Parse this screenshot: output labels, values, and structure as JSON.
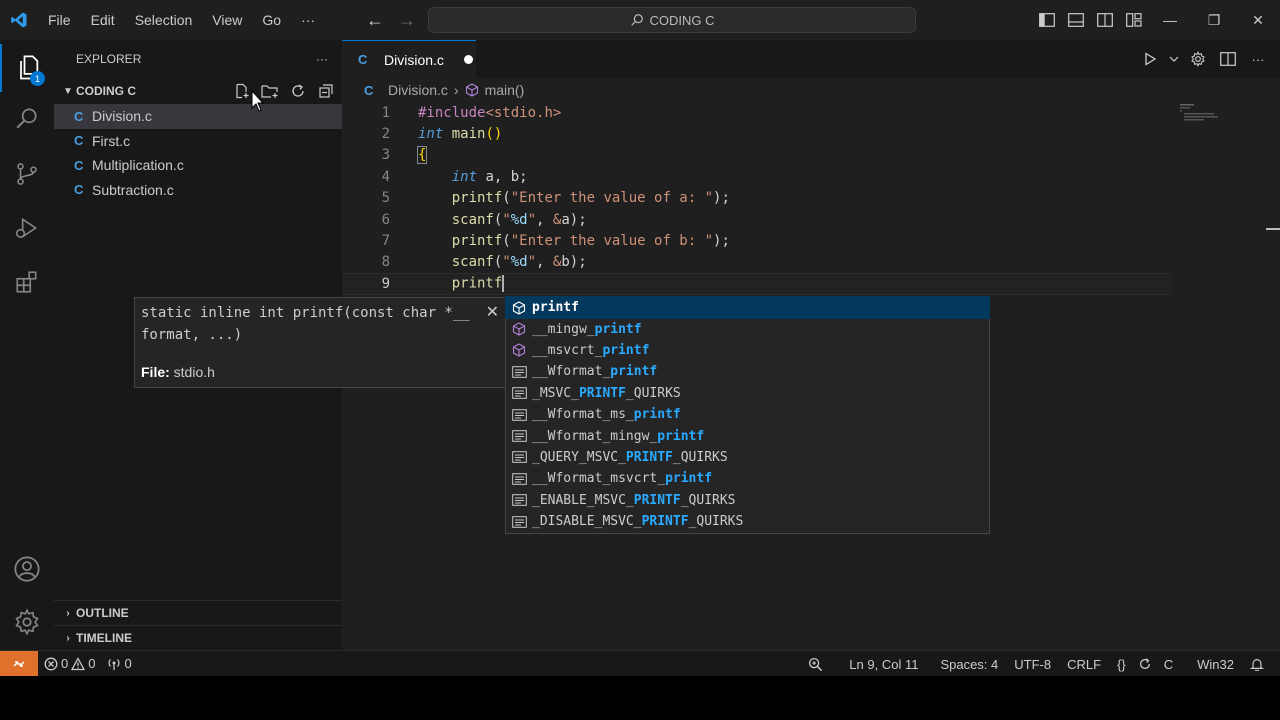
{
  "titlebar": {
    "menu": [
      "File",
      "Edit",
      "Selection",
      "View",
      "Go",
      "···"
    ],
    "search_text": "CODING C"
  },
  "activity": {
    "badge_count": "1"
  },
  "sidebar": {
    "header": "EXPLORER",
    "more": "···",
    "folder": "CODING C",
    "files": [
      "Division.c",
      "First.c",
      "Multiplication.c",
      "Subtraction.c"
    ],
    "outline": "OUTLINE",
    "timeline": "TIMELINE"
  },
  "editor": {
    "tab_label": "Division.c",
    "tab_glyph": "C",
    "breadcrumb_file": "Division.c",
    "breadcrumb_symbol": "main()",
    "line_numbers": [
      "1",
      "2",
      "3",
      "4",
      "5",
      "6",
      "7",
      "8",
      "9"
    ]
  },
  "hover": {
    "signature": "static inline int printf(const char *__ format, ...)",
    "file_label": "File:",
    "file_value": "stdio.h",
    "close": "✕"
  },
  "suggest": {
    "items": [
      {
        "pre": "",
        "match": "printf",
        "post": "",
        "kind": "method"
      },
      {
        "pre": "__mingw_",
        "match": "printf",
        "post": "",
        "kind": "method"
      },
      {
        "pre": "__msvcrt_",
        "match": "printf",
        "post": "",
        "kind": "method"
      },
      {
        "pre": "__Wformat_",
        "match": "printf",
        "post": "",
        "kind": "macro"
      },
      {
        "pre": "_MSVC_",
        "match": "PRINTF",
        "post": "_QUIRKS",
        "kind": "macro"
      },
      {
        "pre": "__Wformat_ms_",
        "match": "printf",
        "post": "",
        "kind": "macro"
      },
      {
        "pre": "__Wformat_mingw_",
        "match": "printf",
        "post": "",
        "kind": "macro"
      },
      {
        "pre": "_QUERY_MSVC_",
        "match": "PRINTF",
        "post": "_QUIRKS",
        "kind": "macro"
      },
      {
        "pre": "__Wformat_msvcrt_",
        "match": "printf",
        "post": "",
        "kind": "macro"
      },
      {
        "pre": "_ENABLE_MSVC_",
        "match": "PRINTF",
        "post": "_QUIRKS",
        "kind": "macro"
      },
      {
        "pre": "_DISABLE_MSVC_",
        "match": "PRINTF",
        "post": "_QUIRKS",
        "kind": "macro"
      }
    ]
  },
  "status": {
    "errors": "0",
    "warnings": "0",
    "ports": "0",
    "position": "Ln 9, Col 11",
    "spaces": "Spaces: 4",
    "encoding": "UTF-8",
    "eol": "CRLF",
    "braces": "{}",
    "language": "C",
    "config": "Win32"
  },
  "colors": {
    "accent": "#0078d4",
    "remote": "#e0712c",
    "selection": "#04395e",
    "match": "#2aaaff"
  }
}
